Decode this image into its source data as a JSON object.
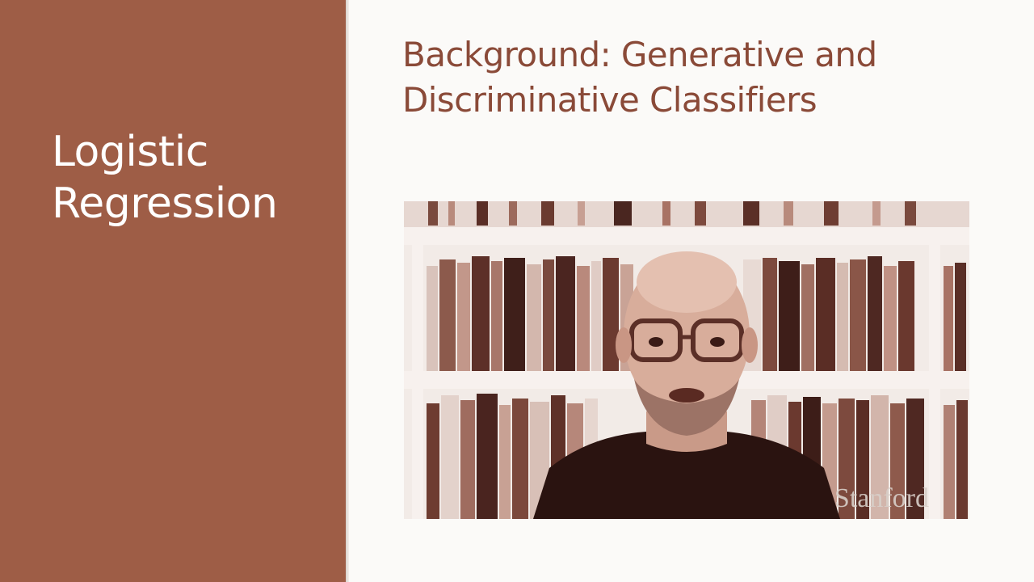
{
  "sidebar": {
    "title_line1": "Logistic",
    "title_line2": "Regression"
  },
  "slide": {
    "title_line1": "Background: Generative and",
    "title_line2": "Discriminative Classifiers"
  },
  "video": {
    "watermark": "Stanford"
  },
  "colors": {
    "panel": "#9e5d46",
    "title": "#8a4a38",
    "background": "#fbfaf8"
  }
}
